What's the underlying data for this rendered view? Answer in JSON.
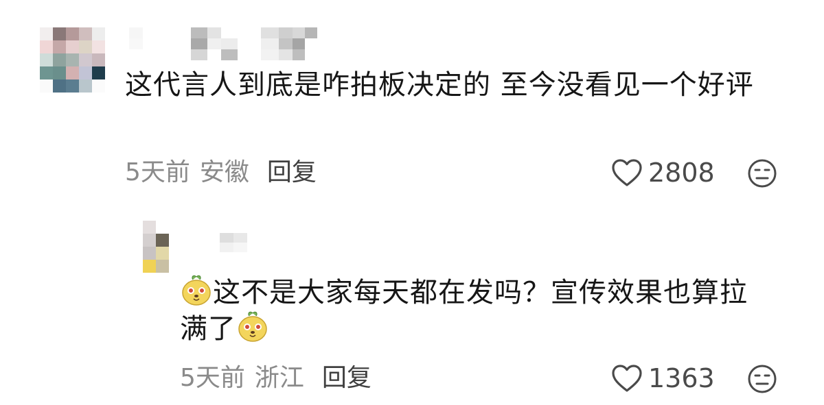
{
  "comments": [
    {
      "text": "这代言人到底是咋拍板决定的 至今没看见一个好评",
      "time": "5天前",
      "location": "安徽",
      "reply_label": "回复",
      "likes": "2808",
      "icons": [
        "heart-outline-icon",
        "expressionless-face-icon"
      ]
    }
  ],
  "replies": [
    {
      "text_before_line_break": "这不是大家每天都在发吗？宣传效果也算拉",
      "text_after_line_break": "满了",
      "emoji": "mango-mascot-emoji",
      "time": "5天前",
      "location": "浙江",
      "reply_label": "回复",
      "likes": "1363",
      "icons": [
        "heart-outline-icon",
        "expressionless-face-icon"
      ]
    }
  ],
  "colors": {
    "text_primary": "#161616",
    "text_meta": "#8a8a8a",
    "reply_label": "#404040",
    "icon_stroke": "#4a4a4a"
  }
}
